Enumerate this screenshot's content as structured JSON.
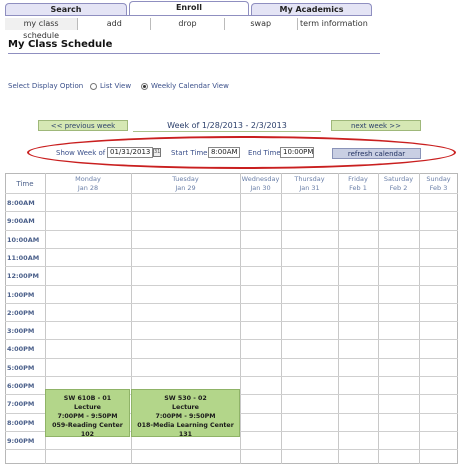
{
  "tabs": [
    {
      "label": "Search"
    },
    {
      "label": "Enroll"
    },
    {
      "label": "My Academics"
    }
  ],
  "subtabs": [
    {
      "label": "my class schedule"
    },
    {
      "label": "add"
    },
    {
      "label": "drop"
    },
    {
      "label": "swap"
    },
    {
      "label": "term information"
    }
  ],
  "page_title": "My Class Schedule",
  "display_option": {
    "label": "Select Display Option",
    "list_view": "List View",
    "weekly_view": "Weekly Calendar View",
    "selected": "weekly"
  },
  "week_nav": {
    "previous": "<< previous week",
    "current": "Week of 1/28/2013 - 2/3/2013",
    "next": "next week >>"
  },
  "filters": {
    "show_week_label": "Show Week of",
    "show_week_value": "01/31/2013",
    "start_time_label": "Start Time",
    "start_time_value": "8:00AM",
    "end_time_label": "End Time",
    "end_time_value": "10:00PM",
    "refresh": "refresh calendar"
  },
  "calendar": {
    "time_header": "Time",
    "days": [
      {
        "day": "Monday",
        "date": "Jan 28"
      },
      {
        "day": "Tuesday",
        "date": "Jan 29"
      },
      {
        "day": "Wednesday",
        "date": "Jan 30"
      },
      {
        "day": "Thursday",
        "date": "Jan 31"
      },
      {
        "day": "Friday",
        "date": "Feb 1"
      },
      {
        "day": "Saturday",
        "date": "Feb 2"
      },
      {
        "day": "Sunday",
        "date": "Feb 3"
      }
    ],
    "times": [
      "8:00AM",
      "9:00AM",
      "10:00AM",
      "11:00AM",
      "12:00PM",
      "1:00PM",
      "2:00PM",
      "3:00PM",
      "4:00PM",
      "5:00PM",
      "6:00PM",
      "7:00PM",
      "8:00PM",
      "9:00PM"
    ],
    "events": [
      {
        "course": "SW 610B - 01",
        "type": "Lecture",
        "time": "7:00PM - 9:50PM",
        "room": "059-Reading Center 102"
      },
      {
        "course": "SW 530 - 02",
        "type": "Lecture",
        "time": "7:00PM - 9:50PM",
        "room": "018-Media Learning Center 131"
      }
    ]
  },
  "colors": {
    "highlight_ellipse": "#c91f1f",
    "event_fill": "#b3d68a",
    "nav_button_fill": "#d6e8b4"
  }
}
